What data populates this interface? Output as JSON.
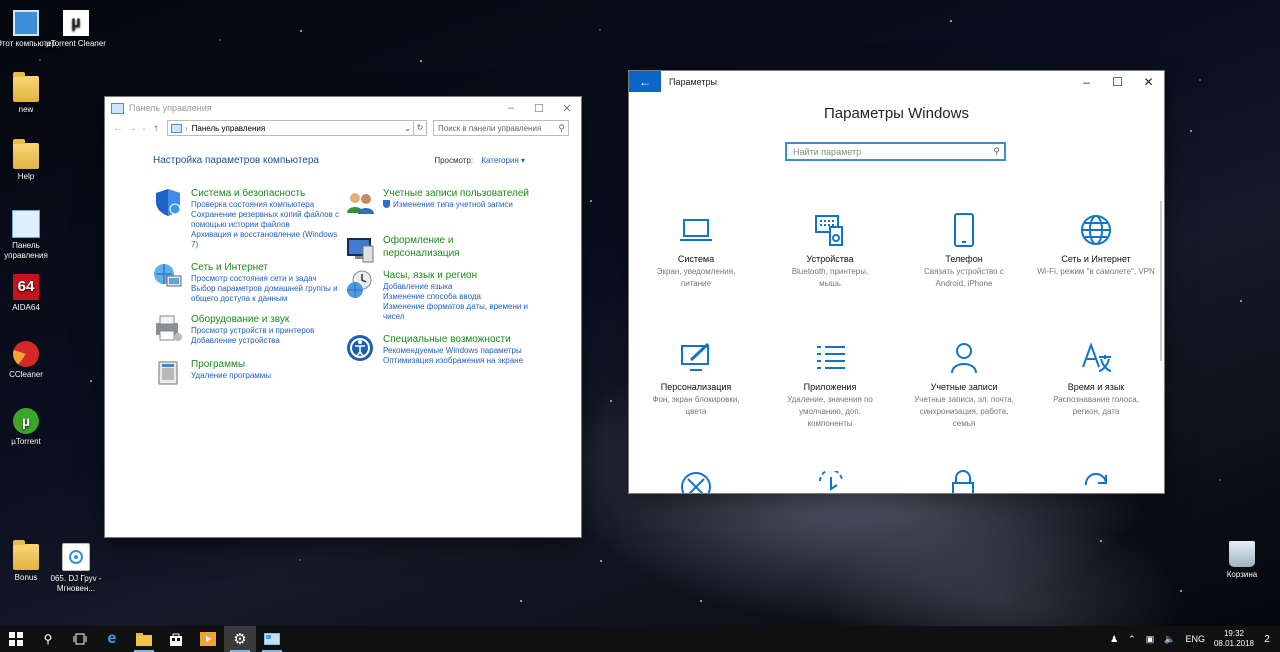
{
  "desktop": {
    "icons_left": [
      {
        "label": "Этот компьютер",
        "icon": "computer-icon"
      },
      {
        "label": "µTorrent Cleaner",
        "icon": "utorrent-cleaner-icon"
      },
      {
        "label": "new",
        "icon": "folder-user-icon"
      },
      {
        "label": "Help",
        "icon": "folder-icon"
      },
      {
        "label": "Панель управления",
        "icon": "control-panel-icon"
      },
      {
        "label": "AIDA64",
        "icon": "aida64-icon"
      },
      {
        "label": "CCleaner",
        "icon": "ccleaner-icon"
      },
      {
        "label": "µTorrent",
        "icon": "utorrent-icon"
      },
      {
        "label": "Bonus",
        "icon": "folder-icon"
      },
      {
        "label": "065. DJ Груv - Мгновен...",
        "icon": "mp3-file-icon"
      }
    ],
    "recycle_bin": {
      "label": "Корзина",
      "icon": "recycle-bin-icon"
    }
  },
  "control_panel": {
    "title": "Панель управления",
    "address": "Панель управления",
    "search_placeholder": "Поиск в панели управления",
    "heading": "Настройка параметров компьютера",
    "view_by_label": "Просмотр:",
    "view_by_value": "Категория",
    "categories_left": [
      {
        "title": "Система и безопасность",
        "icon": "shield-icon",
        "links": [
          "Проверка состояния компьютера",
          "Сохранение резервных копий файлов с помощью истории файлов",
          "Архивация и восстановление (Windows 7)"
        ]
      },
      {
        "title": "Сеть и Интернет",
        "icon": "network-icon",
        "links": [
          "Просмотр состояния сети и задач",
          "Выбор параметров домашней группы и общего доступа к данным"
        ]
      },
      {
        "title": "Оборудование и звук",
        "icon": "printer-icon",
        "links": [
          "Просмотр устройств и принтеров",
          "Добавление устройства"
        ]
      },
      {
        "title": "Программы",
        "icon": "programs-icon",
        "links": [
          "Удаление программы"
        ]
      }
    ],
    "categories_right": [
      {
        "title": "Учетные записи пользователей",
        "icon": "users-icon",
        "links": [
          "Изменение типа учетной записи"
        ]
      },
      {
        "title": "Оформление и персонализация",
        "icon": "appearance-icon",
        "links": []
      },
      {
        "title": "Часы, язык и регион",
        "icon": "clock-globe-icon",
        "links": [
          "Добавление языка",
          "Изменение способа ввода",
          "Изменение форматов даты, времени и чисел"
        ]
      },
      {
        "title": "Специальные возможности",
        "icon": "accessibility-icon",
        "links": [
          "Рекомендуемые Windows параметры",
          "Оптимизация изображения на экране"
        ]
      }
    ]
  },
  "settings": {
    "title": "Параметры",
    "heading": "Параметры Windows",
    "search_placeholder": "Найти параметр",
    "tiles": [
      {
        "title": "Система",
        "desc": "Экран, уведомления, питание",
        "icon": "laptop-icon"
      },
      {
        "title": "Устройства",
        "desc": "Bluetooth, принтеры, мышь",
        "icon": "devices-icon"
      },
      {
        "title": "Телефон",
        "desc": "Связать устройство с Android, iPhone",
        "icon": "phone-icon"
      },
      {
        "title": "Сеть и Интернет",
        "desc": "Wi-Fi, режим \"в самолете\", VPN",
        "icon": "globe-icon"
      },
      {
        "title": "Персонализация",
        "desc": "Фон, экран блокировки, цвета",
        "icon": "personalization-icon"
      },
      {
        "title": "Приложения",
        "desc": "Удаление, значения по умолчанию, доп. компоненты",
        "icon": "apps-list-icon"
      },
      {
        "title": "Учетные записи",
        "desc": "Учетные записи, эл. почта, синхронизация, работа, семья",
        "icon": "person-icon"
      },
      {
        "title": "Время и язык",
        "desc": "Распознавание голоса, регион, дата",
        "icon": "time-language-icon"
      }
    ]
  },
  "taskbar": {
    "items": [
      "windows-start-icon",
      "search-icon",
      "task-view-icon",
      "edge-icon",
      "file-explorer-icon",
      "store-icon",
      "media-icon",
      "settings-gear-icon",
      "control-panel-icon"
    ],
    "language": "ENG",
    "time": "19:32",
    "date": "08.01.2018",
    "notifications": "2"
  },
  "colors": {
    "accent": "#0a67c8",
    "cp_link": "#1f5fc4",
    "cp_category": "#1a8a1a",
    "settings_icon": "#1274c8"
  }
}
